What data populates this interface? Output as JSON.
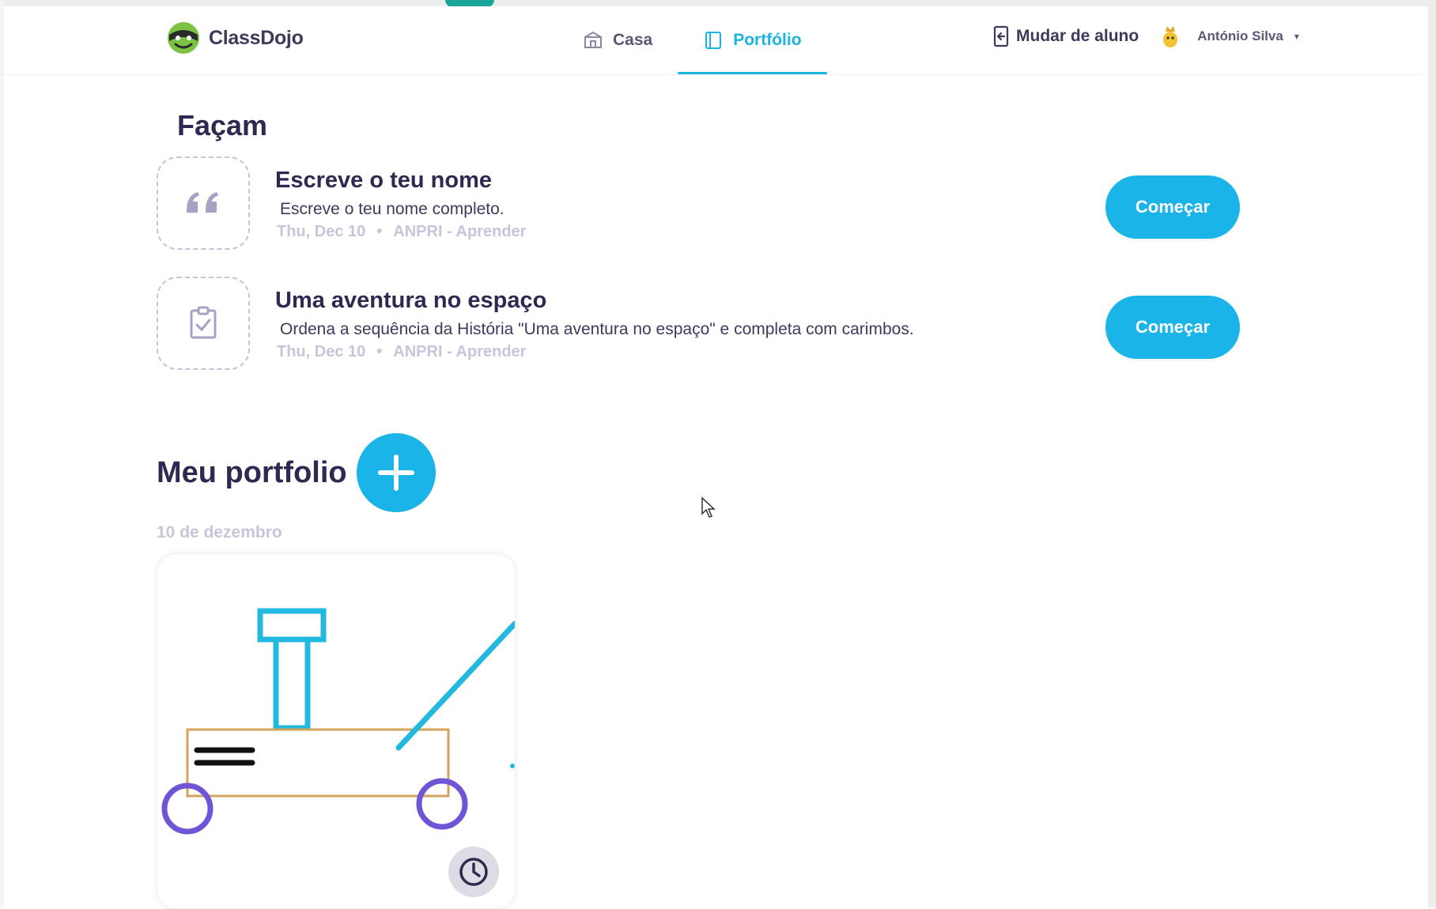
{
  "app": {
    "name": "ClassDojo"
  },
  "nav": {
    "tabs": [
      {
        "label": "Casa",
        "icon": "home-icon",
        "active": false
      },
      {
        "label": "Portfólio",
        "icon": "portfolio-icon",
        "active": true
      }
    ]
  },
  "header": {
    "switch_label": "Mudar de aluno",
    "user_name": "António Silva",
    "caret": "▾"
  },
  "todo": {
    "title": "Façam",
    "items": [
      {
        "title": "Escreve o teu nome",
        "description": "Escreve o teu nome completo.",
        "date": "Thu, Dec 10",
        "separator": "•",
        "class": "ANPRI - Aprender",
        "icon": "quote-icon",
        "button": "Começar"
      },
      {
        "title": "Uma aventura no espaço",
        "description": "Ordena a sequência da História \"Uma aventura no espaço\" e completa com carimbos.",
        "date": "Thu, Dec 10",
        "separator": "•",
        "class": "ANPRI - Aprender",
        "icon": "clipboard-check-icon",
        "button": "Começar"
      }
    ]
  },
  "portfolio": {
    "title": "Meu portfolio",
    "date_label": "10 de dezembro"
  },
  "colors": {
    "accent": "#1bb4e8",
    "title": "#2c2a50",
    "meta": "#c7c5d8",
    "drawing_cyan": "#22b8e0",
    "drawing_purple": "#6f55d6",
    "drawing_tan": "#d4a25a"
  }
}
